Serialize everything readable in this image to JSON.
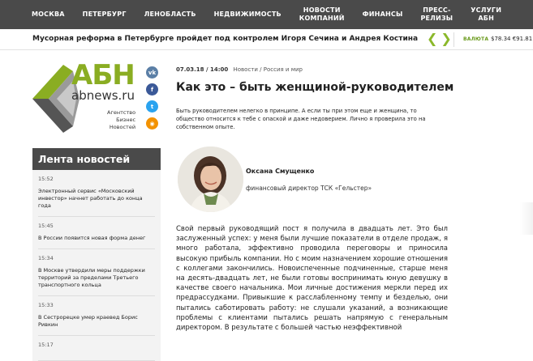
{
  "nav": {
    "items": [
      {
        "label": "МОСКВА"
      },
      {
        "label": "ПЕТЕРБУРГ"
      },
      {
        "label": "ЛЕНОБЛАСТЬ"
      },
      {
        "label": "НЕДВИЖИМОСТЬ"
      },
      {
        "label": "НОВОСТИ\nКОМПАНИЙ"
      },
      {
        "label": "ФИНАНСЫ"
      },
      {
        "label": "ПРЕСС-\nРЕЛИЗЫ"
      },
      {
        "label": "УСЛУГИ\nАБН"
      }
    ]
  },
  "ticker": {
    "headline": "Мусорная реформа в Петербурге пройдет под контролем Игоря Сечина и Андрея Костина",
    "prev_icon": "chevron-left-icon",
    "next_icon": "chevron-right-icon",
    "prev_glyph": "❮",
    "next_glyph": "❯",
    "currency_label": "ВАЛЮТА",
    "currency_values": "$78.34 €91.81"
  },
  "logo": {
    "abbr": "АБН",
    "domain": "abnews.ru",
    "tagline_1": "Агентство",
    "tagline_2": "Бизнес",
    "tagline_3": "Новостей"
  },
  "social": {
    "items": [
      {
        "icon": "vk-icon",
        "glyph": "vk",
        "color": "#5b7fa6"
      },
      {
        "icon": "facebook-icon",
        "glyph": "f",
        "color": "#3b5998"
      },
      {
        "icon": "twitter-icon",
        "glyph": "t",
        "color": "#2aa3ef"
      },
      {
        "icon": "rss-icon",
        "glyph": "◉",
        "color": "#f39200"
      }
    ]
  },
  "feed": {
    "title": "Лента новостей",
    "items": [
      {
        "time": "15:52",
        "text": "Электронный сервис «Московский инвестор» начнет работать до конца года"
      },
      {
        "time": "15:45",
        "text": "В России появится новая форма денег"
      },
      {
        "time": "15:34",
        "text": "В Москве утвердили меры поддержки территорий за пределами Третьего транспортного кольца"
      },
      {
        "time": "15:33",
        "text": "В Сестрорецке умер краевед Борис Ривкин"
      },
      {
        "time": "15:17",
        "text": ""
      }
    ]
  },
  "article": {
    "date": "07.03.18 / 14:00",
    "breadcrumb": "Новости / Россия и мир",
    "title": "Как это – быть женщиной-руководителем",
    "lead": "Быть руководителем нелегко в принципе. А если ты при этом еще и женщина, то общество относится к тебе с опаской и даже недоверием. Лично я проверила это на собственном опыте.",
    "author_name": "Оксана Смущенко",
    "author_role": "финансовый директор ТСК «Гельстер»",
    "body": "Свой первый руководящий пост я получила в двадцать лет. Это был заслуженный успех: у меня были лучшие показатели в отделе продаж, я много работала, эффективно проводила переговоры и приносила высокую прибыль компании. Но с моим назначением хорошие отношения с коллегами закончились. Новоиспеченные подчиненные, старше меня на десять-двадцать лет, не были готовы воспринимать юную девушку в качестве своего начальника. Мои личные достижения меркли перед их предрассудками. Привыкшие к расслабленному темпу и безделью, они пытались саботировать работу: не слушали указаний, а возникающие проблемы с клиентами пытались решать напрямую с генеральным директором. В результате с большей частью неэффективной"
  }
}
